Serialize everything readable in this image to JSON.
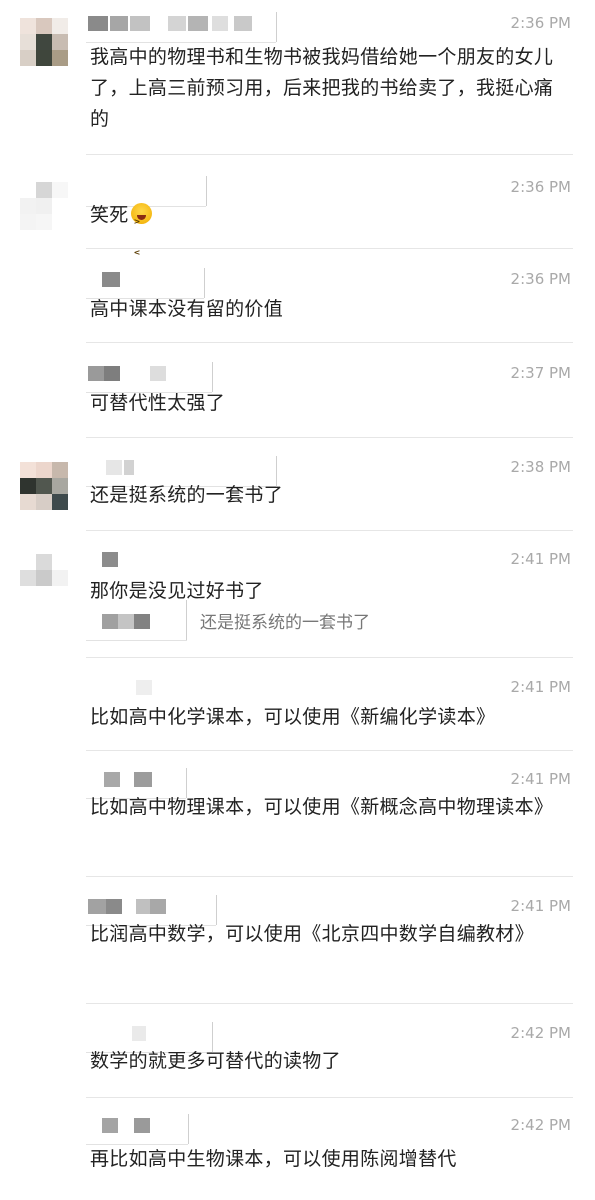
{
  "colors": {
    "background": "#ffffff",
    "message_text": "#222222",
    "timestamp": "#a9a9a9",
    "quote_text": "#777777",
    "separator": "#e6e6e6"
  },
  "messages": [
    {
      "time": "2:36 PM",
      "text": "我高中的物理书和生物书被我妈借给她一个朋友的女儿了，上高三前预习用，后来把我的书给卖了，我挺心痛的",
      "sender": "redacted",
      "avatar": "pixelated"
    },
    {
      "time": "2:36 PM",
      "text": "笑死",
      "emoji": "laughing-face",
      "sender": "redacted",
      "avatar": "pixelated"
    },
    {
      "time": "2:36 PM",
      "text": "高中课本没有留的价值",
      "sender": "redacted"
    },
    {
      "time": "2:37 PM",
      "text": "可替代性太强了",
      "sender": "redacted"
    },
    {
      "time": "2:38 PM",
      "text": "还是挺系统的一套书了",
      "sender": "redacted",
      "avatar": "pixelated"
    },
    {
      "time": "2:41 PM",
      "text": "那你是没见过好书了",
      "sender": "redacted",
      "avatar": "pixelated",
      "quote": "还是挺系统的一套书了"
    },
    {
      "time": "2:41 PM",
      "text": "比如高中化学课本，可以使用《新编化学读本》",
      "sender": "redacted"
    },
    {
      "time": "2:41 PM",
      "text": "比如高中物理课本，可以使用《新概念高中物理读本》",
      "sender": "redacted"
    },
    {
      "time": "2:41 PM",
      "text": "比润高中数学，可以使用《北京四中数学自编教材》",
      "sender": "redacted"
    },
    {
      "time": "2:42 PM",
      "text": "数学的就更多可替代的读物了",
      "sender": "redacted"
    },
    {
      "time": "2:42 PM",
      "text": "再比如高中生物课本，可以使用陈阅增替代",
      "sender": "redacted"
    }
  ]
}
